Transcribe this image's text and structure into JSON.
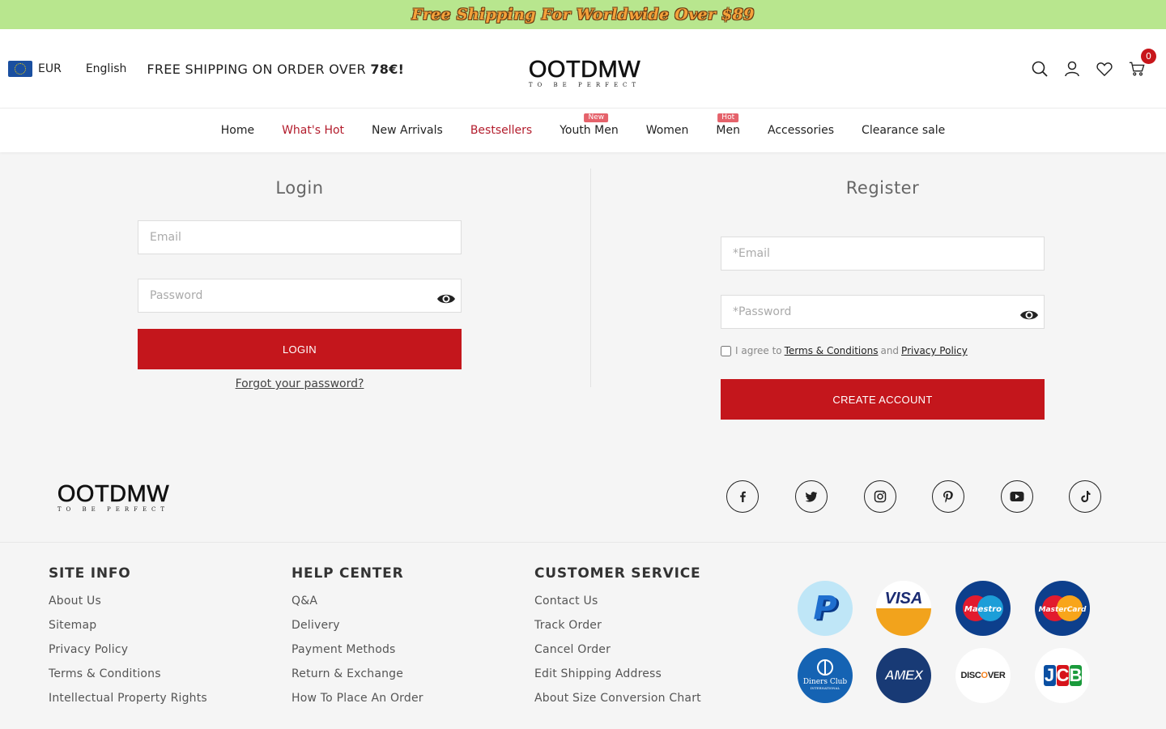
{
  "promo": {
    "text": "Free Shipping For Worldwide Over $89"
  },
  "header": {
    "currency": "EUR",
    "language": "English",
    "shipping_note_prefix": "FREE SHIPPING ON ORDER OVER ",
    "shipping_note_amount": "78€!",
    "logo": {
      "main": "OOTDMW",
      "tagline": "TO BE PERFECT"
    },
    "icons": [
      "search-icon",
      "user-icon",
      "heart-icon",
      "cart-icon"
    ],
    "cart_count": "0"
  },
  "nav": {
    "items": [
      {
        "label": "Home"
      },
      {
        "label": "What's Hot"
      },
      {
        "label": "New Arrivals"
      },
      {
        "label": "Bestsellers"
      },
      {
        "label": " Youth Men",
        "badge": "New"
      },
      {
        "label": "Women"
      },
      {
        "label": "Men",
        "badge": "Hot"
      },
      {
        "label": "Accessories"
      },
      {
        "label": "Clearance sale"
      }
    ]
  },
  "login": {
    "title": "Login",
    "email_placeholder": "Email",
    "password_placeholder": "Password",
    "button": "LOGIN",
    "forgot": "Forgot your password?"
  },
  "register": {
    "title": "Register",
    "email_placeholder": "*Email",
    "password_placeholder": "*Password",
    "agree_prefix": "I agree to",
    "terms_link": "Terms & Conditions",
    "agree_mid": "and",
    "privacy_link": "Privacy Policy",
    "button": "CREATE ACCOUNT"
  },
  "footer": {
    "logo": {
      "main": "OOTDMW",
      "tagline": "TO BE PERFECT"
    },
    "social_icons": [
      "facebook-icon",
      "twitter-icon",
      "instagram-icon",
      "pinterest-icon",
      "youtube-icon",
      "tiktok-icon"
    ],
    "columns": [
      {
        "title": "SITE INFO",
        "links": [
          "About Us",
          "Sitemap",
          "Privacy Policy",
          "Terms & Conditions",
          "Intellectual Property Rights"
        ]
      },
      {
        "title": "HELP CENTER",
        "links": [
          "Q&A",
          "Delivery",
          "Payment Methods",
          "Return & Exchange",
          "How To Place An Order"
        ]
      },
      {
        "title": "CUSTOMER SERVICE",
        "links": [
          "Contact Us",
          "Track Order",
          "Cancel Order",
          "Edit Shipping Address",
          "About Size Conversion Chart"
        ]
      }
    ],
    "payments": [
      "P",
      "VISA",
      "Maestro",
      "MasterCard",
      "Diners Club",
      "INTERNATIONAL",
      "AMEX",
      "DISCOVER",
      "JCB"
    ]
  },
  "colors": {
    "accent": "#c4161c",
    "promo_bg": "#b8e68e",
    "nav_red": "#b31c2c"
  }
}
